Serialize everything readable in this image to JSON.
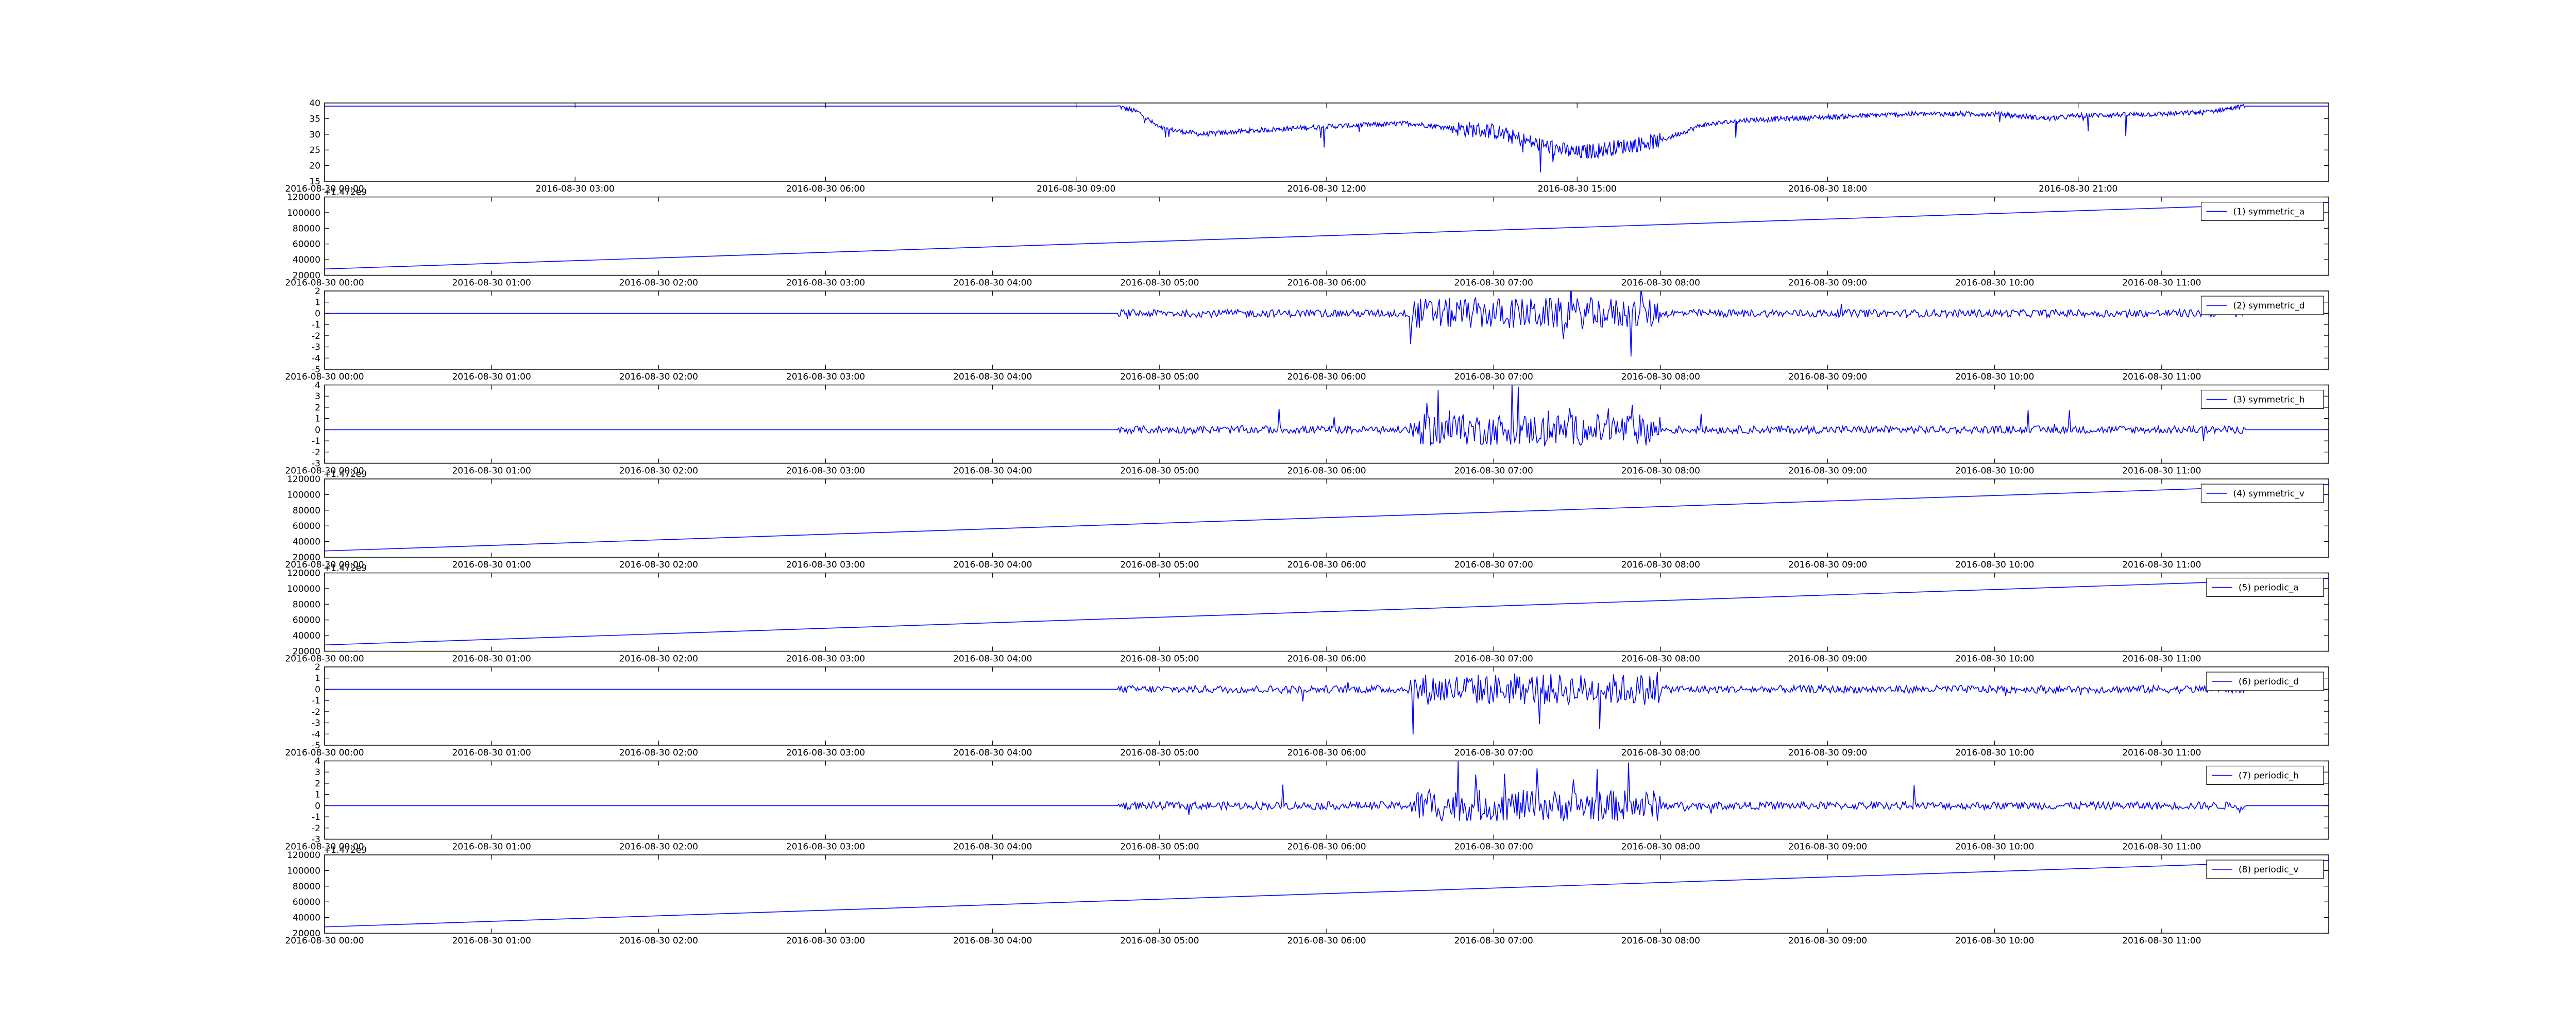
{
  "figure": {
    "line_color": "#0000ff",
    "frame_color": "#000000",
    "background": "#ffffff"
  },
  "chart_data": [
    {
      "type": "line",
      "title": "",
      "xlabel": "",
      "ylabel": "",
      "xrange": [
        "2016-08-30 00:00",
        "2016-08-31 00:00"
      ],
      "ylim": [
        15,
        40
      ],
      "yticks": [
        "15",
        "20",
        "25",
        "30",
        "35",
        "40"
      ],
      "xticks": [
        "2016-08-30 00:00",
        "2016-08-30 03:00",
        "2016-08-30 06:00",
        "2016-08-30 09:00",
        "2016-08-30 12:00",
        "2016-08-30 15:00",
        "2016-08-30 18:00",
        "2016-08-30 21:00"
      ],
      "offset_text": "",
      "legend": null,
      "grid": false,
      "series": [
        {
          "x": [
            "2016-08-30 00:00",
            "2016-08-30 09:30",
            "2016-08-30 09:45",
            "2016-08-30 10:00",
            "2016-08-30 10:30",
            "2016-08-30 11:00",
            "2016-08-30 12:00",
            "2016-08-30 13:00",
            "2016-08-30 13:30",
            "2016-08-30 14:00",
            "2016-08-30 14:30",
            "2016-08-30 15:00",
            "2016-08-30 15:30",
            "2016-08-30 16:00",
            "2016-08-30 16:30",
            "2016-08-30 17:00",
            "2016-08-30 18:00",
            "2016-08-30 19:00",
            "2016-08-30 20:00",
            "2016-08-30 20:40",
            "2016-08-30 21:00",
            "2016-08-30 22:00",
            "2016-08-30 22:30",
            "2016-08-30 23:00",
            "2016-08-31 00:00"
          ],
          "values": [
            39,
            39,
            37,
            32,
            30,
            31,
            32.5,
            33.5,
            32,
            31,
            27,
            24,
            26,
            28,
            33,
            34.5,
            35.5,
            36.5,
            36.5,
            35,
            36,
            36.5,
            37,
            39,
            39
          ]
        }
      ]
    },
    {
      "type": "line",
      "xrange": [
        "2016-08-30 00:00",
        "2016-08-30 12:00"
      ],
      "ylim": [
        20000,
        120000
      ],
      "yticks": [
        "20000",
        "40000",
        "60000",
        "80000",
        "100000",
        "120000"
      ],
      "xticks": [
        "2016-08-30 00:00",
        "2016-08-30 01:00",
        "2016-08-30 02:00",
        "2016-08-30 03:00",
        "2016-08-30 04:00",
        "2016-08-30 05:00",
        "2016-08-30 06:00",
        "2016-08-30 07:00",
        "2016-08-30 08:00",
        "2016-08-30 09:00",
        "2016-08-30 10:00",
        "2016-08-30 11:00"
      ],
      "offset_text": "+1.472e9",
      "legend": "top-right",
      "series": [
        {
          "name": "(1) symmetric_a",
          "x": [
            "2016-08-30 00:00",
            "2016-08-30 12:00"
          ],
          "values": [
            28000,
            113000
          ]
        }
      ]
    },
    {
      "type": "line",
      "xrange": [
        "2016-08-30 00:00",
        "2016-08-30 12:00"
      ],
      "ylim": [
        -5,
        2
      ],
      "yticks": [
        "-5",
        "-4",
        "-3",
        "-2",
        "-1",
        "0",
        "1",
        "2"
      ],
      "xticks": [
        "2016-08-30 00:00",
        "2016-08-30 01:00",
        "2016-08-30 02:00",
        "2016-08-30 03:00",
        "2016-08-30 04:00",
        "2016-08-30 05:00",
        "2016-08-30 06:00",
        "2016-08-30 07:00",
        "2016-08-30 08:00",
        "2016-08-30 09:00",
        "2016-08-30 10:00",
        "2016-08-30 11:00"
      ],
      "offset_text": "",
      "legend": "top-right",
      "series": [
        {
          "name": "(2) symmetric_d",
          "x": [
            "2016-08-30 00:00",
            "2016-08-30 12:00"
          ],
          "values": [
            0,
            0
          ]
        }
      ]
    },
    {
      "type": "line",
      "xrange": [
        "2016-08-30 00:00",
        "2016-08-30 12:00"
      ],
      "ylim": [
        -3,
        4
      ],
      "yticks": [
        "-3",
        "-2",
        "-1",
        "0",
        "1",
        "2",
        "3",
        "4"
      ],
      "xticks": [
        "2016-08-30 00:00",
        "2016-08-30 01:00",
        "2016-08-30 02:00",
        "2016-08-30 03:00",
        "2016-08-30 04:00",
        "2016-08-30 05:00",
        "2016-08-30 06:00",
        "2016-08-30 07:00",
        "2016-08-30 08:00",
        "2016-08-30 09:00",
        "2016-08-30 10:00",
        "2016-08-30 11:00"
      ],
      "offset_text": "",
      "legend": "top-right",
      "series": [
        {
          "name": "(3) symmetric_h",
          "x": [
            "2016-08-30 00:00",
            "2016-08-30 12:00"
          ],
          "values": [
            0,
            0
          ]
        }
      ]
    },
    {
      "type": "line",
      "xrange": [
        "2016-08-30 00:00",
        "2016-08-30 12:00"
      ],
      "ylim": [
        20000,
        120000
      ],
      "yticks": [
        "20000",
        "40000",
        "60000",
        "80000",
        "100000",
        "120000"
      ],
      "xticks": [
        "2016-08-30 00:00",
        "2016-08-30 01:00",
        "2016-08-30 02:00",
        "2016-08-30 03:00",
        "2016-08-30 04:00",
        "2016-08-30 05:00",
        "2016-08-30 06:00",
        "2016-08-30 07:00",
        "2016-08-30 08:00",
        "2016-08-30 09:00",
        "2016-08-30 10:00",
        "2016-08-30 11:00"
      ],
      "offset_text": "+1.472e9",
      "legend": "top-right",
      "series": [
        {
          "name": "(4) symmetric_v",
          "x": [
            "2016-08-30 00:00",
            "2016-08-30 12:00"
          ],
          "values": [
            28000,
            113000
          ]
        }
      ]
    },
    {
      "type": "line",
      "xrange": [
        "2016-08-30 00:00",
        "2016-08-30 12:00"
      ],
      "ylim": [
        20000,
        120000
      ],
      "yticks": [
        "20000",
        "40000",
        "60000",
        "80000",
        "100000",
        "120000"
      ],
      "xticks": [
        "2016-08-30 00:00",
        "2016-08-30 01:00",
        "2016-08-30 02:00",
        "2016-08-30 03:00",
        "2016-08-30 04:00",
        "2016-08-30 05:00",
        "2016-08-30 06:00",
        "2016-08-30 07:00",
        "2016-08-30 08:00",
        "2016-08-30 09:00",
        "2016-08-30 10:00",
        "2016-08-30 11:00"
      ],
      "offset_text": "+1.472e9",
      "legend": "top-right",
      "series": [
        {
          "name": "(5) periodic_a",
          "x": [
            "2016-08-30 00:00",
            "2016-08-30 12:00"
          ],
          "values": [
            28000,
            113000
          ]
        }
      ]
    },
    {
      "type": "line",
      "xrange": [
        "2016-08-30 00:00",
        "2016-08-30 12:00"
      ],
      "ylim": [
        -5,
        2
      ],
      "yticks": [
        "-5",
        "-4",
        "-3",
        "-2",
        "-1",
        "0",
        "1",
        "2"
      ],
      "xticks": [
        "2016-08-30 00:00",
        "2016-08-30 01:00",
        "2016-08-30 02:00",
        "2016-08-30 03:00",
        "2016-08-30 04:00",
        "2016-08-30 05:00",
        "2016-08-30 06:00",
        "2016-08-30 07:00",
        "2016-08-30 08:00",
        "2016-08-30 09:00",
        "2016-08-30 10:00",
        "2016-08-30 11:00"
      ],
      "offset_text": "",
      "legend": "top-right",
      "series": [
        {
          "name": "(6) periodic_d",
          "x": [
            "2016-08-30 00:00",
            "2016-08-30 12:00"
          ],
          "values": [
            0,
            0
          ]
        }
      ]
    },
    {
      "type": "line",
      "xrange": [
        "2016-08-30 00:00",
        "2016-08-30 12:00"
      ],
      "ylim": [
        -3,
        4
      ],
      "yticks": [
        "-3",
        "-2",
        "-1",
        "0",
        "1",
        "2",
        "3",
        "4"
      ],
      "xticks": [
        "2016-08-30 00:00",
        "2016-08-30 01:00",
        "2016-08-30 02:00",
        "2016-08-30 03:00",
        "2016-08-30 04:00",
        "2016-08-30 05:00",
        "2016-08-30 06:00",
        "2016-08-30 07:00",
        "2016-08-30 08:00",
        "2016-08-30 09:00",
        "2016-08-30 10:00",
        "2016-08-30 11:00"
      ],
      "offset_text": "",
      "legend": "top-right",
      "series": [
        {
          "name": "(7) periodic_h",
          "x": [
            "2016-08-30 00:00",
            "2016-08-30 12:00"
          ],
          "values": [
            0,
            0
          ]
        }
      ]
    },
    {
      "type": "line",
      "xrange": [
        "2016-08-30 00:00",
        "2016-08-30 12:00"
      ],
      "ylim": [
        20000,
        120000
      ],
      "yticks": [
        "20000",
        "40000",
        "60000",
        "80000",
        "100000",
        "120000"
      ],
      "xticks": [
        "2016-08-30 00:00",
        "2016-08-30 01:00",
        "2016-08-30 02:00",
        "2016-08-30 03:00",
        "2016-08-30 04:00",
        "2016-08-30 05:00",
        "2016-08-30 06:00",
        "2016-08-30 07:00",
        "2016-08-30 08:00",
        "2016-08-30 09:00",
        "2016-08-30 10:00",
        "2016-08-30 11:00"
      ],
      "offset_text": "+1.472e9",
      "legend": "top-right",
      "series": [
        {
          "name": "(8) periodic_v",
          "x": [
            "2016-08-30 00:00",
            "2016-08-30 12:00"
          ],
          "values": [
            28000,
            113000
          ]
        }
      ]
    }
  ]
}
